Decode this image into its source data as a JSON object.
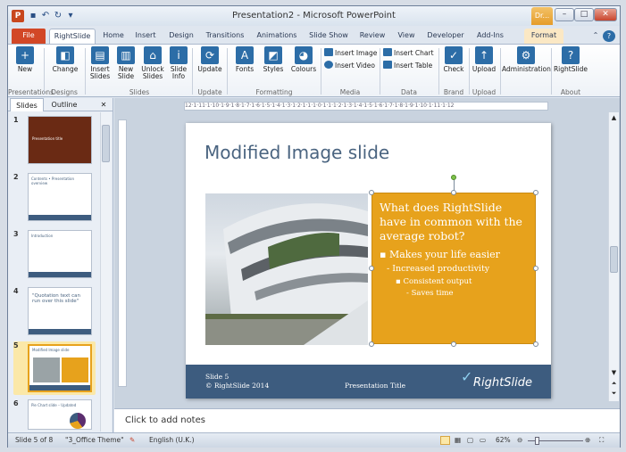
{
  "window": {
    "title": "Presentation2 - Microsoft PowerPoint",
    "ctx_group": "Dr..."
  },
  "tabs": [
    "File",
    "RightSlide",
    "Home",
    "Insert",
    "Design",
    "Transitions",
    "Animations",
    "Slide Show",
    "Review",
    "View",
    "Developer",
    "Add-Ins",
    "Format"
  ],
  "ribbon": {
    "buttons": {
      "new": "New",
      "change": "Change",
      "insert_slides": "Insert Slides",
      "new_slide": "New Slide",
      "unlock_slides": "Unlock Slides",
      "slide_info": "Slide Info",
      "update": "Update",
      "fonts": "Fonts",
      "styles": "Styles",
      "colours": "Colours",
      "insert_image": "Insert Image",
      "insert_video": "Insert Video",
      "insert_chart": "Insert Chart",
      "insert_table": "Insert Table",
      "check": "Check",
      "upload": "Upload",
      "administration": "Administration",
      "rightslide": "RightSlide"
    },
    "groups": [
      "Presentations",
      "Designs",
      "Slides",
      "Update",
      "Formatting",
      "Media",
      "Data",
      "Brand",
      "Upload",
      "About"
    ]
  },
  "panel": {
    "tabs": [
      "Slides",
      "Outline"
    ],
    "thumbs": [
      {
        "num": "1",
        "title": "Presentation title"
      },
      {
        "num": "2",
        "title": "Contents • Presentation overview"
      },
      {
        "num": "3",
        "title": "Introduction"
      },
      {
        "num": "4",
        "title": "\"Quotation text can run over this slide\""
      },
      {
        "num": "5",
        "title": "Modified Image slide"
      },
      {
        "num": "6",
        "title": "Pie Chart slide – Updated"
      }
    ]
  },
  "slide": {
    "title": "Modified Image slide",
    "box_title": "What does RightSlide have in common with the average robot?",
    "b1": "Makes your life easier",
    "b2": "Increased productivity",
    "b3": "Consistent output",
    "b4": "Saves time",
    "footer_slide": "Slide 5",
    "footer_brand": "© RightSlide 2014",
    "footer_pres": "Presentation Title",
    "logo": "RightSlide"
  },
  "notes": {
    "placeholder": "Click to add notes"
  },
  "status": {
    "slide_info": "Slide 5 of 8",
    "theme": "\"3_Office Theme\"",
    "language": "English (U.K.)",
    "zoom": "62%"
  },
  "ruler": "12·1·11·1·10·1·9·1·8·1·7·1·6·1·5·1·4·1·3·1·2·1·1·1·0·1·1·1·2·1·3·1·4·1·5·1·6·1·7·1·8·1·9·1·10·1·11·1·12",
  "colors": {
    "accent": "#e7a21c",
    "footer": "#3d5c7f",
    "file_tab": "#d24726",
    "title": "#4a6480"
  }
}
